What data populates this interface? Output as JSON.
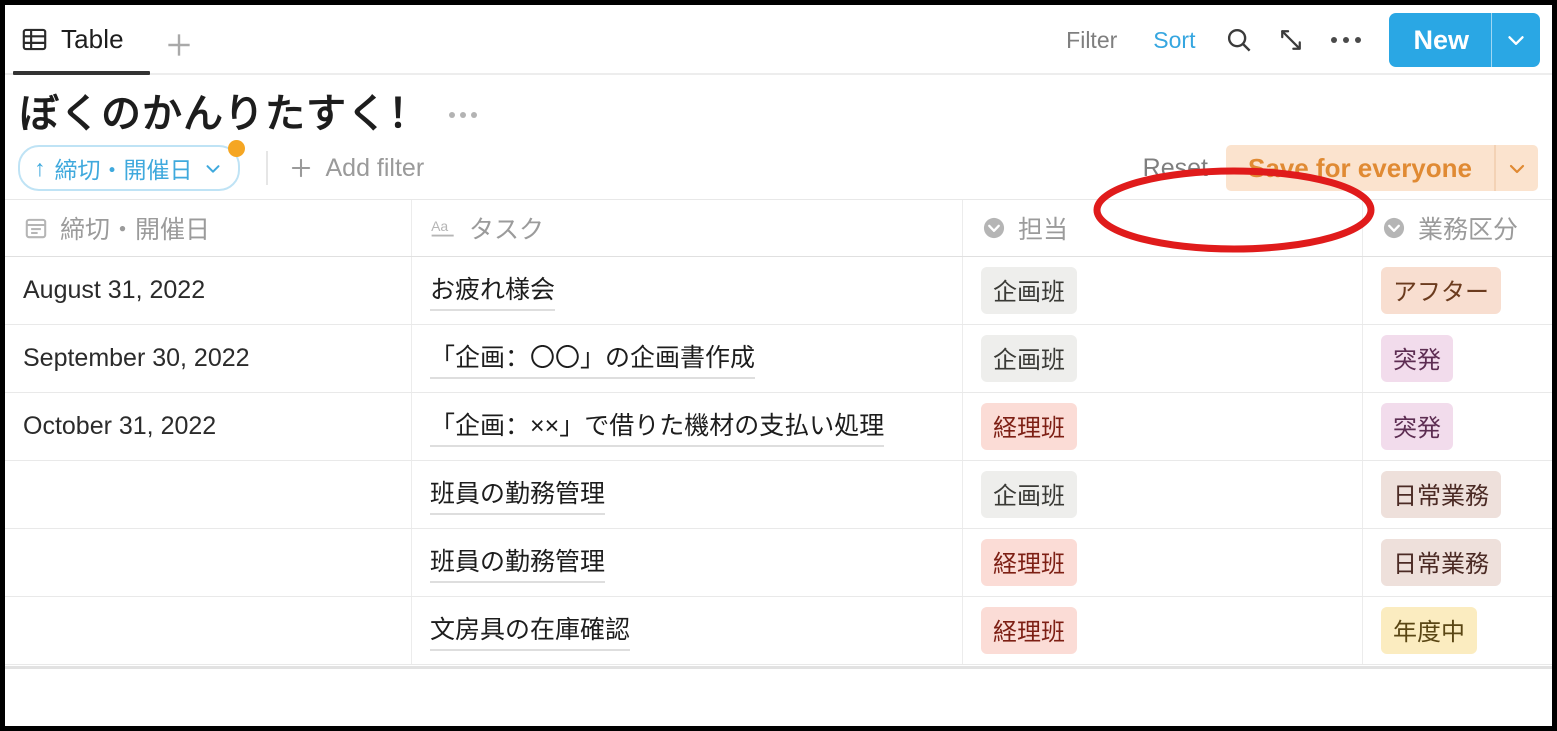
{
  "tabbar": {
    "tab_label": "Table",
    "tab_icon": "table-grid-icon",
    "add_tab_icon": "plus-icon",
    "filter_label": "Filter",
    "sort_label": "Sort",
    "search_icon": "search-icon",
    "expand_icon": "expand-diagonal-icon",
    "more_icon": "ellipsis-icon",
    "new_label": "New",
    "new_caret_icon": "chevron-down-icon",
    "accent_color": "#35a6e0",
    "new_button_color": "#2aa7e4"
  },
  "title": {
    "text": "ぼくのかんりたすく！",
    "more_icon": "ellipsis-icon"
  },
  "filterbar": {
    "sort_chip": {
      "direction_icon": "arrow-up-icon",
      "direction_glyph": "↑",
      "field": "締切・開催日",
      "caret_icon": "chevron-down-icon",
      "badge_color": "#f5a623",
      "text_color": "#3fa9dd"
    },
    "divider": true,
    "add_filter_label": "Add filter",
    "add_filter_icon": "plus-icon",
    "reset_label": "Reset",
    "save_label": "Save for everyone",
    "save_caret_icon": "chevron-down-icon",
    "save_bg_color": "#fbe3ce",
    "save_text_color": "#e08a33"
  },
  "annotation": {
    "shape": "ellipse",
    "color": "#e01b1b",
    "target": "Save for everyone"
  },
  "table": {
    "columns": [
      {
        "label": "締切・開催日",
        "icon": "calendar-icon",
        "type": "date"
      },
      {
        "label": "タスク",
        "icon": "text-aa-icon",
        "type": "text"
      },
      {
        "label": "担当",
        "icon": "single-select-icon",
        "type": "select"
      },
      {
        "label": "業務区分",
        "icon": "single-select-icon",
        "type": "select"
      }
    ],
    "rows": [
      {
        "date": "August 31, 2022",
        "task": "お疲れ様会",
        "owner": "企画班",
        "owner_bg": "#eeeeec",
        "owner_fg": "#3a3a36",
        "category": "アフター",
        "category_bg": "#f8ded0",
        "category_fg": "#6b3b1e"
      },
      {
        "date": "September 30, 2022",
        "task": "「企画：〇〇」の企画書作成",
        "owner": "企画班",
        "owner_bg": "#eeeeec",
        "owner_fg": "#3a3a36",
        "category": "突発",
        "category_bg": "#f2dcec",
        "category_fg": "#5d2d52"
      },
      {
        "date": "October 31, 2022",
        "task": "「企画：××」で借りた機材の支払い処理",
        "owner": "経理班",
        "owner_bg": "#fbdcd6",
        "owner_fg": "#7d1f14",
        "category": "突発",
        "category_bg": "#f2dcec",
        "category_fg": "#5d2d52"
      },
      {
        "date": "",
        "task": "班員の勤務管理",
        "owner": "企画班",
        "owner_bg": "#eeeeec",
        "owner_fg": "#3a3a36",
        "category": "日常業務",
        "category_bg": "#eee0db",
        "category_fg": "#4b2a24"
      },
      {
        "date": "",
        "task": "班員の勤務管理",
        "owner": "経理班",
        "owner_bg": "#fbdcd6",
        "owner_fg": "#7d1f14",
        "category": "日常業務",
        "category_bg": "#eee0db",
        "category_fg": "#4b2a24"
      },
      {
        "date": "",
        "task": "文房具の在庫確認",
        "owner": "経理班",
        "owner_bg": "#fbdcd6",
        "owner_fg": "#7d1f14",
        "category": "年度中",
        "category_bg": "#fbecc0",
        "category_fg": "#5a4614"
      }
    ]
  }
}
